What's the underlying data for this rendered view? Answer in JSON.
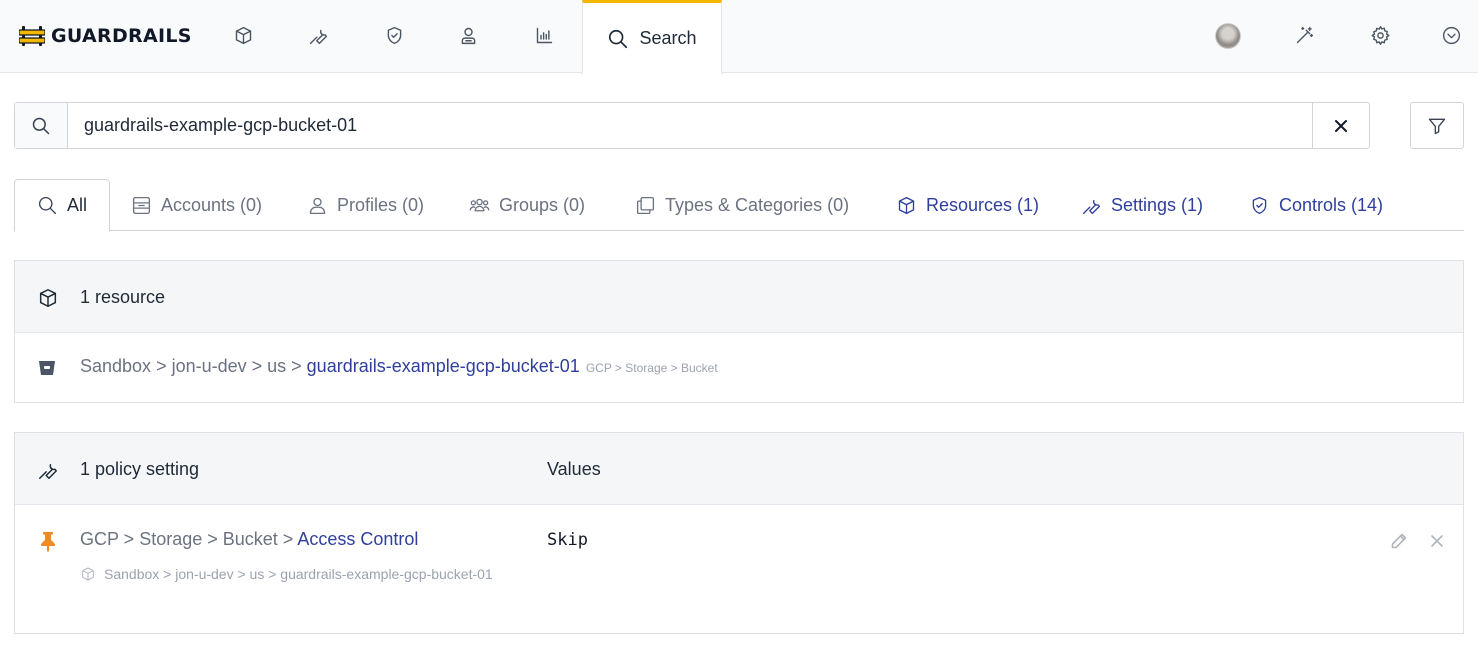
{
  "brand": {
    "name": "GUARDRAILS",
    "accent": "#f5b800",
    "link_color": "#2f3f9e"
  },
  "topnav": {
    "icons": [
      "cube-icon",
      "wrench-icon",
      "shield-check-icon",
      "user-badge-icon",
      "bar-chart-icon"
    ],
    "search_tab_label": "Search",
    "right_icons": [
      "avatar",
      "magic-wand-icon",
      "gear-icon",
      "chevron-down-circle-icon"
    ]
  },
  "search": {
    "value": "guardrails-example-gcp-bucket-01"
  },
  "tabs": [
    {
      "label": "All",
      "icon": "search-icon",
      "active": true
    },
    {
      "label": "Accounts (0)",
      "icon": "account-icon"
    },
    {
      "label": "Profiles (0)",
      "icon": "user-icon"
    },
    {
      "label": "Groups (0)",
      "icon": "users-icon"
    },
    {
      "label": "Types & Categories (0)",
      "icon": "copy-icon"
    },
    {
      "label": "Resources (1)",
      "icon": "cube-icon"
    },
    {
      "label": "Settings (1)",
      "icon": "wrench-icon"
    },
    {
      "label": "Controls (14)",
      "icon": "shield-check-icon"
    }
  ],
  "resources_panel": {
    "title": "1 resource",
    "rows": [
      {
        "path": [
          "Sandbox",
          "jon-u-dev",
          "us"
        ],
        "name": "guardrails-example-gcp-bucket-01",
        "type_path": "GCP > Storage > Bucket",
        "separator": " > "
      }
    ]
  },
  "settings_panel": {
    "title": "1 policy setting",
    "values_header": "Values",
    "rows": [
      {
        "path_prefix": "GCP > Storage > Bucket > ",
        "policy_name": "Access Control",
        "scope": "Sandbox > jon-u-dev > us > guardrails-example-gcp-bucket-01",
        "value": "Skip"
      }
    ]
  }
}
